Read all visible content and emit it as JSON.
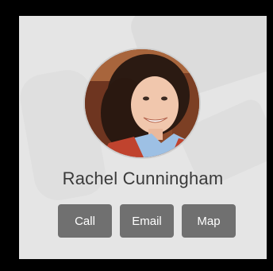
{
  "contact": {
    "name": "Rachel Cunningham"
  },
  "actions": {
    "call_label": "Call",
    "email_label": "Email",
    "map_label": "Map"
  },
  "colors": {
    "card_background": "#e5e5e5",
    "button_background": "#707070",
    "button_text": "#ffffff",
    "name_text": "#3a3a3a",
    "frame": "#000000"
  }
}
